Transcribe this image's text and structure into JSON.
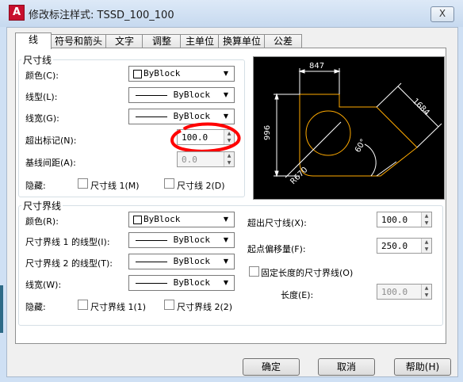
{
  "window": {
    "title": "修改标注样式: TSSD_100_100",
    "close_label": "X",
    "app_icon": "A"
  },
  "tabs": [
    "线",
    "符号和箭头",
    "文字",
    "调整",
    "主单位",
    "换算单位",
    "公差"
  ],
  "dim_lines": {
    "legend": "尺寸线",
    "color_label": "颜色(C):",
    "color_value": "ByBlock",
    "linetype_label": "线型(L):",
    "linetype_value": "ByBlock",
    "lineweight_label": "线宽(G):",
    "lineweight_value": "ByBlock",
    "extend_ticks_label": "超出标记(N):",
    "extend_ticks_value": "100.0",
    "baseline_spacing_label": "基线间距(A):",
    "baseline_spacing_value": "0.0",
    "suppress_label": "隐藏:",
    "suppress_1": "尺寸线 1(M)",
    "suppress_2": "尺寸线 2(D)"
  },
  "ext_lines": {
    "legend": "尺寸界线",
    "color_label": "颜色(R):",
    "color_value": "ByBlock",
    "linetype1_label": "尺寸界线 1 的线型(I):",
    "linetype1_value": "ByBlock",
    "linetype2_label": "尺寸界线 2 的线型(T):",
    "linetype2_value": "ByBlock",
    "lineweight_label": "线宽(W):",
    "lineweight_value": "ByBlock",
    "suppress_label": "隐藏:",
    "suppress_1": "尺寸界线 1(1)",
    "suppress_2": "尺寸界线 2(2)",
    "extend_beyond_label": "超出尺寸线(X):",
    "extend_beyond_value": "100.0",
    "offset_label": "起点偏移量(F):",
    "offset_value": "250.0",
    "fixed_length_label": "固定长度的尺寸界线(O)",
    "length_label": "长度(E):",
    "length_value": "100.0"
  },
  "preview": {
    "dim_top": "847",
    "dim_left": "996",
    "dim_right": "1684",
    "dim_angle": "60°",
    "dim_radius": "R670"
  },
  "buttons": {
    "ok": "确定",
    "cancel": "取消",
    "help": "帮助(H)"
  },
  "colors": {
    "preview_bg": "#000000",
    "preview_geometry": "#ffaa00",
    "preview_dims": "#ffffff",
    "highlight": "#ff0000"
  }
}
